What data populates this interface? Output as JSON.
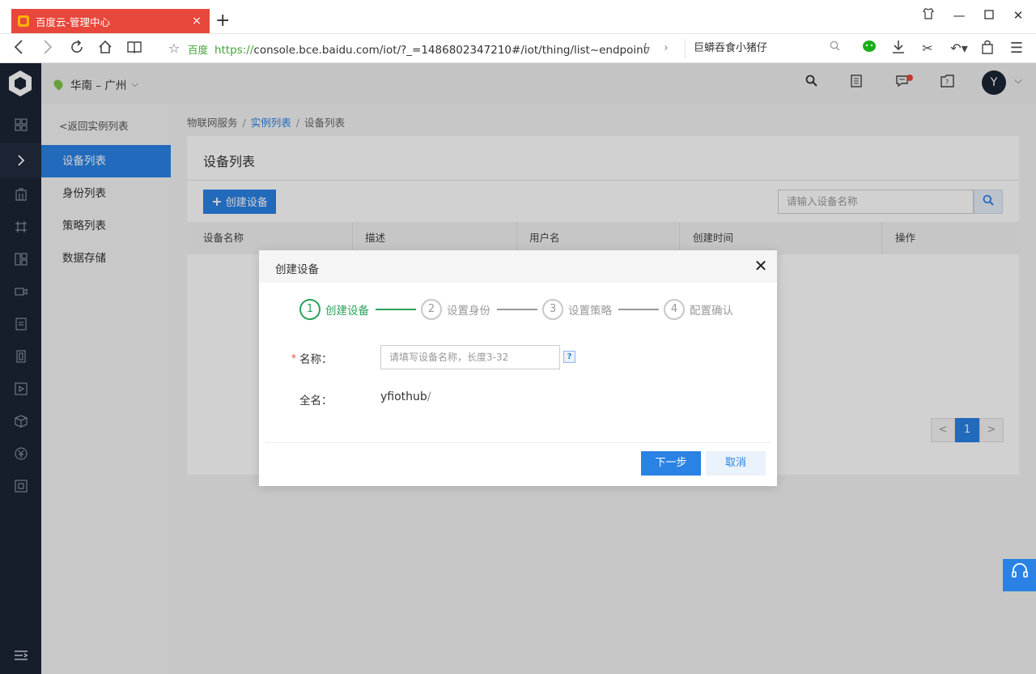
{
  "browser": {
    "tab_title": "百度云-管理中心",
    "tab_close": "×",
    "new_tab": "+",
    "address_brand": "百度",
    "address_scheme": "https://",
    "address_rest": "console.bce.baidu.com/iot/?_=1486802347210#/iot/thing/list~endpoint",
    "search_text": "巨蟒吞食小猪仔"
  },
  "console": {
    "region": "华南 – 广州",
    "avatar_letter": "Y"
  },
  "sidebar": {
    "back_link": "<返回实例列表",
    "items": [
      {
        "label": "设备列表"
      },
      {
        "label": "身份列表"
      },
      {
        "label": "策略列表"
      },
      {
        "label": "数据存储"
      }
    ]
  },
  "breadcrumb": {
    "items": [
      "物联网服务",
      "实例列表",
      "设备列表"
    ]
  },
  "panel": {
    "title": "设备列表",
    "create_button": "创建设备",
    "search_placeholder": "请输入设备名称",
    "columns": [
      "设备名称",
      "描述",
      "用户名",
      "创建时间",
      "操作"
    ],
    "pager": {
      "prev": "<",
      "current": "1",
      "next": ">"
    }
  },
  "modal": {
    "title": "创建设备",
    "steps": [
      {
        "num": "1",
        "label": "创建设备",
        "active": true
      },
      {
        "num": "2",
        "label": "设置身份",
        "active": false
      },
      {
        "num": "3",
        "label": "设置策略",
        "active": false
      },
      {
        "num": "4",
        "label": "配置确认",
        "active": false
      }
    ],
    "name_label": "名称：",
    "required_mark": "*",
    "name_placeholder": "请填写设备名称，长度3-32",
    "help_mark": "?",
    "fullname_label": "全名：",
    "fullname_prefix": "yfiothub",
    "fullname_sep": "/",
    "next_button": "下一步",
    "cancel_button": "取消"
  },
  "colors": {
    "accent": "#2a82e4",
    "step_active": "#29a35a",
    "tab_red": "#e8473b",
    "rail_dark": "#1c2435"
  }
}
